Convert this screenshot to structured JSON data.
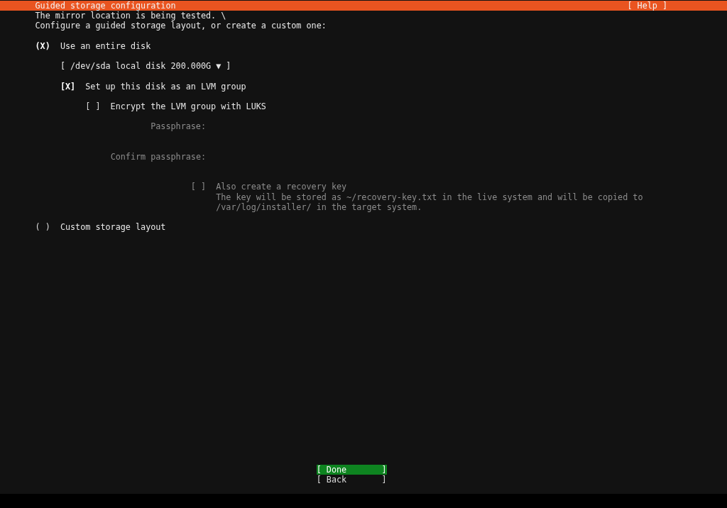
{
  "header": {
    "title": "Guided storage configuration",
    "help": "[ Help ]"
  },
  "messages": [
    "The mirror location is being tested. \\",
    "Configure a guided storage layout, or create a custom one:"
  ],
  "entire_disk": {
    "indicator": "(X)",
    "label": "Use an entire disk",
    "selected": true
  },
  "disk_dropdown": "[ /dev/sda local disk 200.000G ▼ ]",
  "lvm": {
    "indicator": "[X]",
    "label": "Set up this disk as an LVM group",
    "checked": true
  },
  "encrypt": {
    "indicator": "[ ]",
    "label": "Encrypt the LVM group with LUKS",
    "checked": false
  },
  "fields": [
    {
      "label": "Passphrase:",
      "disabled": true
    },
    {
      "label": "Confirm passphrase:",
      "disabled": true
    }
  ],
  "recovery": {
    "indicator": "[ ]",
    "label": "Also create a recovery key",
    "checked": false,
    "disabled": true,
    "description": [
      "The key will be stored as ~/recovery-key.txt in the live system and will be copied to",
      "/var/log/installer/ in the target system."
    ]
  },
  "custom_layout": {
    "indicator": "( )",
    "label": "Custom storage layout",
    "selected": false
  },
  "buttons": [
    {
      "label": "[ Done       ]",
      "selected": true
    },
    {
      "label": "[ Back       ]",
      "selected": false
    }
  ]
}
